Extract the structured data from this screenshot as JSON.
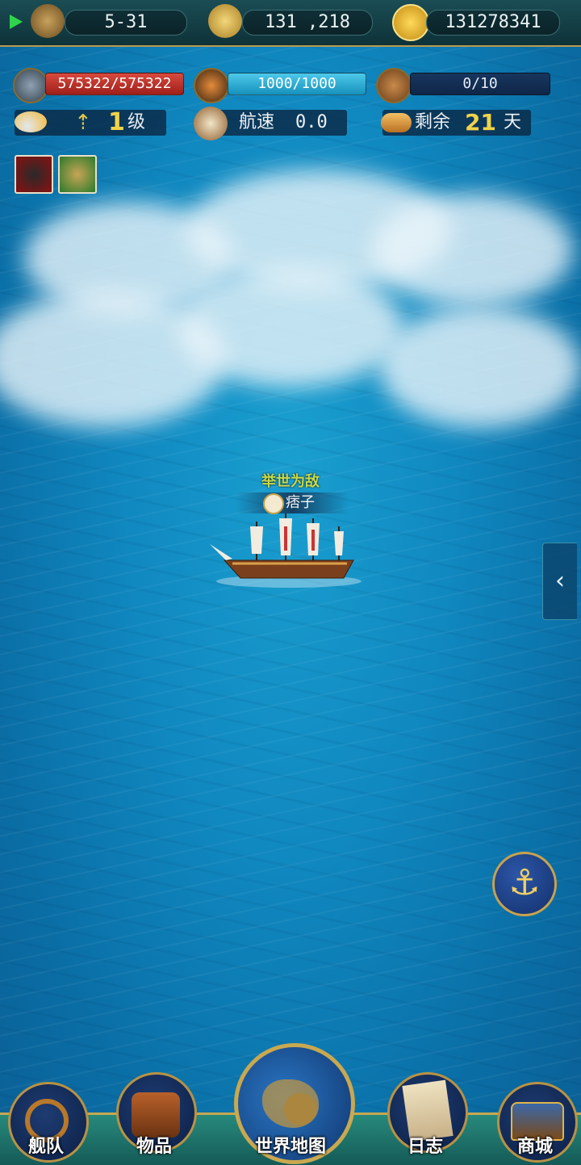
{
  "top_bar": {
    "date": "5-31",
    "coordinates": "131 ,218",
    "gold": "131278341"
  },
  "stats": {
    "durability": "575322/575322",
    "crew": "1000/1000",
    "cargo": "0/10",
    "level_value": "1",
    "level_unit": "级",
    "speed_label": "航速",
    "speed_value": "0.0",
    "days_label": "剩余",
    "days_value": "21",
    "days_unit": "天"
  },
  "ship": {
    "status": "举世为敌",
    "name": "痞子"
  },
  "side_tab": {
    "icon": "chevron-left-icon",
    "glyph": "‹"
  },
  "anchor": {
    "icon": "anchor-icon",
    "glyph": "⚓"
  },
  "nav": {
    "fleet": "舰队",
    "items": "物品",
    "world_map": "世界地图",
    "log": "日志",
    "shop": "商城"
  },
  "colors": {
    "durability_bar": "#c6302a",
    "crew_bar": "#1fb0d8",
    "accent_gold": "#e6c64a",
    "ship_status": "#c6d94a"
  }
}
